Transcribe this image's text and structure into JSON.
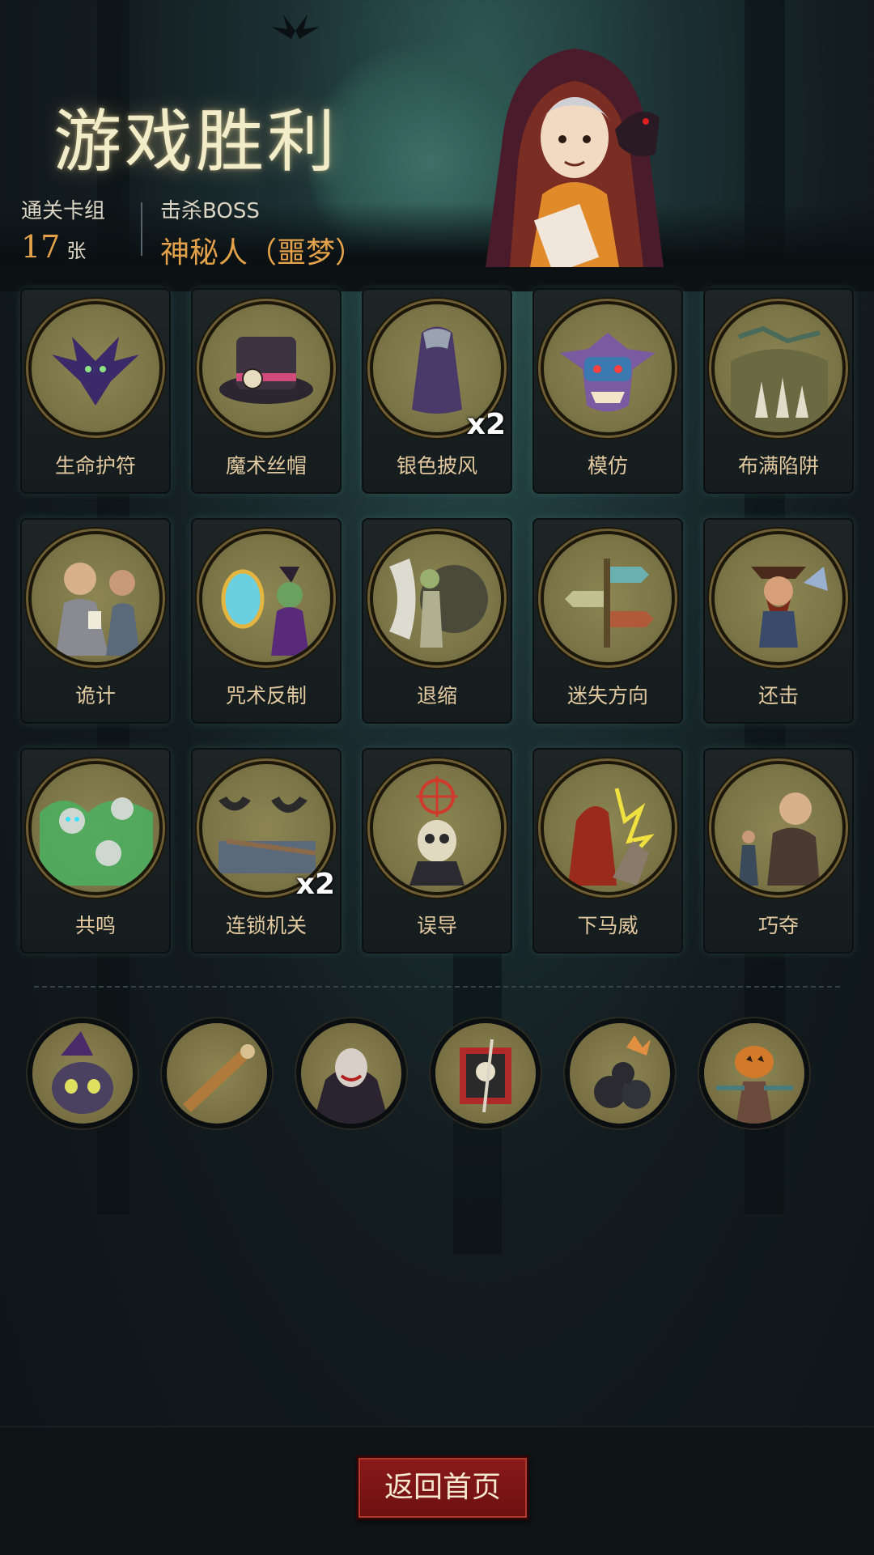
{
  "header": {
    "title": "游戏胜利",
    "deck_label": "通关卡组",
    "deck_count": "17",
    "deck_unit": "张",
    "boss_label": "击杀BOSS",
    "boss_name": "神秘人（噩梦）"
  },
  "cards": [
    {
      "name": "生命护符",
      "icon": "bat-icon",
      "count": ""
    },
    {
      "name": "魔术丝帽",
      "icon": "top-hat-icon",
      "count": ""
    },
    {
      "name": "银色披风",
      "icon": "cloak-icon",
      "count": "x2"
    },
    {
      "name": "模仿",
      "icon": "goblin-mask-icon",
      "count": ""
    },
    {
      "name": "布满陷阱",
      "icon": "spike-trap-icon",
      "count": ""
    },
    {
      "name": "诡计",
      "icon": "card-players-icon",
      "count": ""
    },
    {
      "name": "咒术反制",
      "icon": "witch-mirror-icon",
      "count": ""
    },
    {
      "name": "退缩",
      "icon": "retreat-icon",
      "count": ""
    },
    {
      "name": "迷失方向",
      "icon": "signpost-icon",
      "count": ""
    },
    {
      "name": "还击",
      "icon": "pirate-icon",
      "count": ""
    },
    {
      "name": "共鸣",
      "icon": "skulls-icon",
      "count": ""
    },
    {
      "name": "连锁机关",
      "icon": "blade-trap-icon",
      "count": "x2"
    },
    {
      "name": "误导",
      "icon": "target-skull-icon",
      "count": ""
    },
    {
      "name": "下马威",
      "icon": "strike-icon",
      "count": ""
    },
    {
      "name": "巧夺",
      "icon": "thief-icon",
      "count": ""
    }
  ],
  "relics": [
    {
      "icon": "witch-cat-icon"
    },
    {
      "icon": "spyglass-icon"
    },
    {
      "icon": "vampire-icon"
    },
    {
      "icon": "pirate-flag-icon"
    },
    {
      "icon": "bombs-icon"
    },
    {
      "icon": "pumpkin-scarecrow-icon"
    }
  ],
  "footer": {
    "home_label": "返回首页"
  },
  "colors": {
    "accent_gold": "#e3a24a",
    "button_red": "#7a1414",
    "token_olive": "#8c8553"
  }
}
